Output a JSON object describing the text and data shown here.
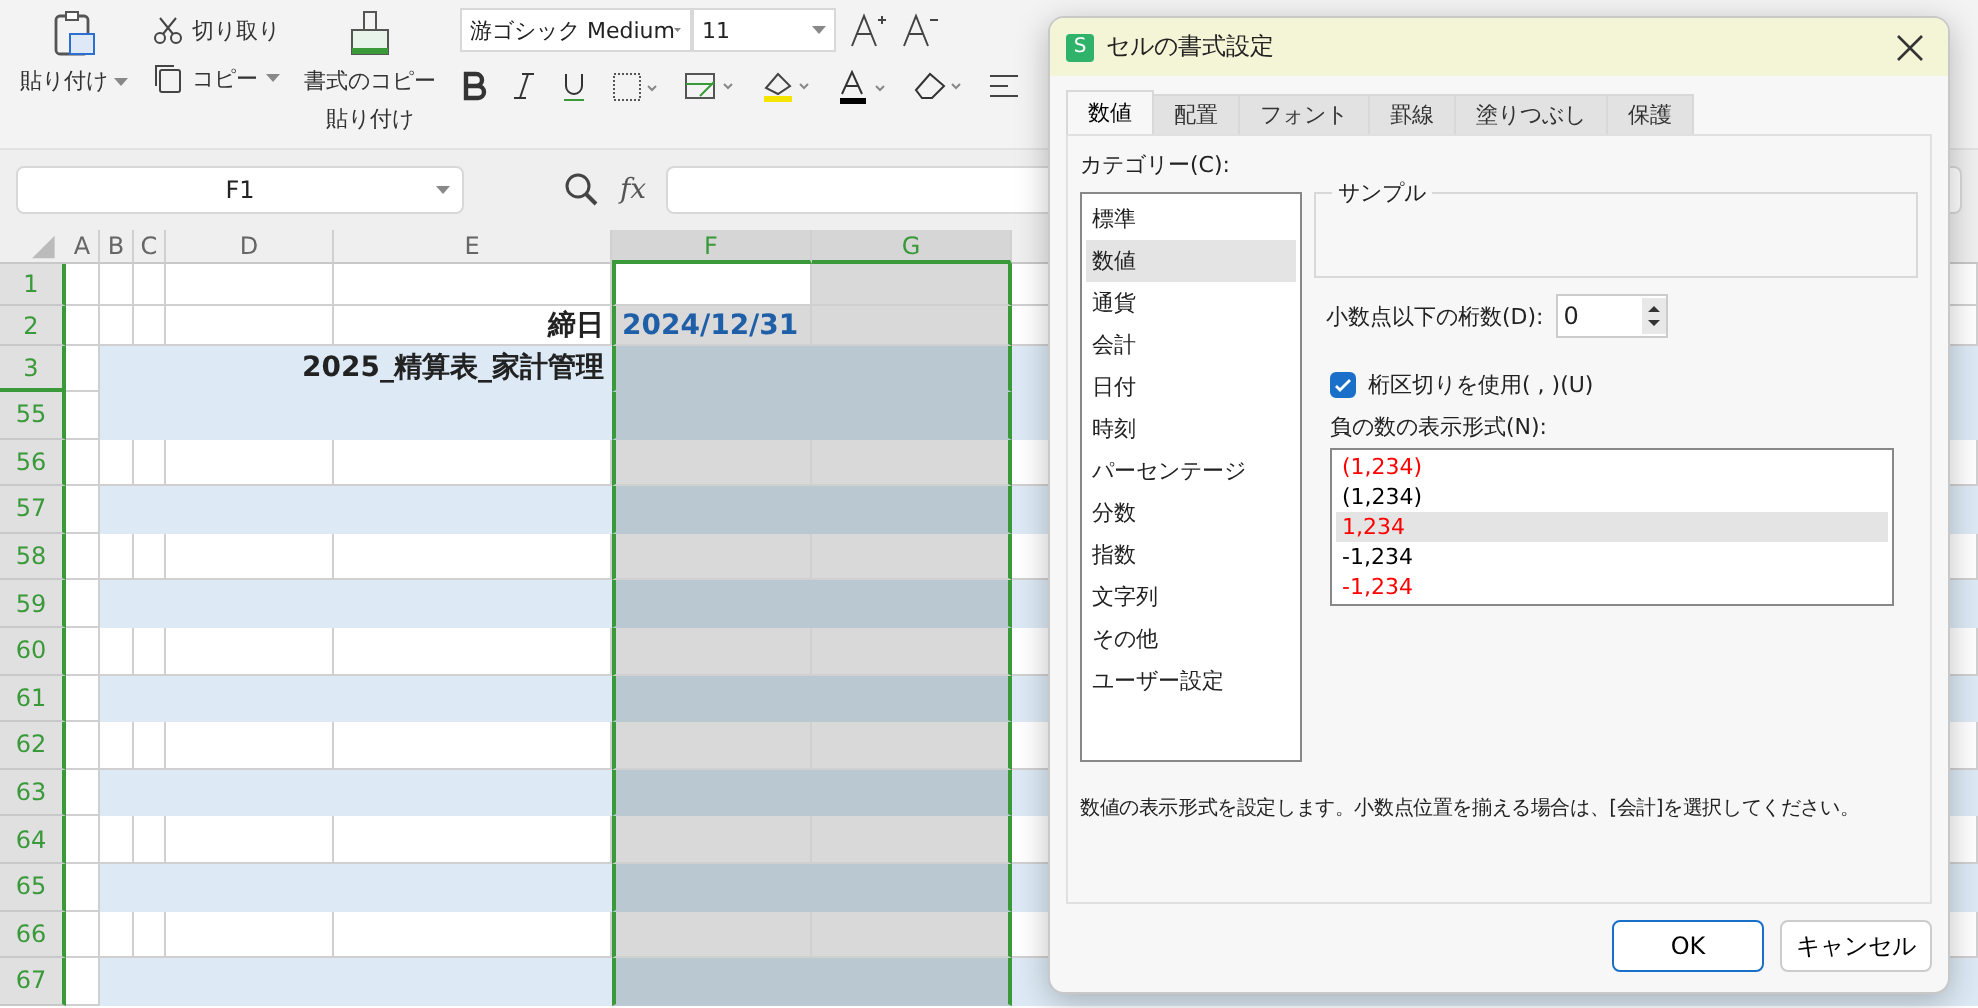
{
  "toolbar": {
    "paste": "貼り付け",
    "cut": "切り取り",
    "copy": "コピー",
    "format_painter": [
      "書式のコピー",
      "貼り付け"
    ],
    "font": "游ゴシック Medium",
    "size": "11"
  },
  "formula_bar": {
    "name_box": "F1",
    "fx": "fx"
  },
  "sheet": {
    "columns": [
      {
        "label": "A",
        "selected": false
      },
      {
        "label": "B",
        "selected": false
      },
      {
        "label": "C",
        "selected": false
      },
      {
        "label": "D",
        "selected": false
      },
      {
        "label": "E",
        "selected": false
      },
      {
        "label": "F",
        "selected": true
      },
      {
        "label": "G",
        "selected": true
      }
    ],
    "rows": [
      {
        "label": "1",
        "kind": "plain",
        "active": true
      },
      {
        "label": "2",
        "kind": "plain",
        "active": false,
        "e": "締日",
        "f": "2024/12/31"
      },
      {
        "label": "3",
        "kind": "title",
        "active": false,
        "e": "2025_精算表_家計管理"
      },
      {
        "label": "55",
        "kind": "band",
        "active": false
      },
      {
        "label": "56",
        "kind": "plain",
        "active": false
      },
      {
        "label": "57",
        "kind": "band",
        "active": false
      },
      {
        "label": "58",
        "kind": "plain",
        "active": false
      },
      {
        "label": "59",
        "kind": "band",
        "active": false
      },
      {
        "label": "60",
        "kind": "plain",
        "active": false
      },
      {
        "label": "61",
        "kind": "band",
        "active": false
      },
      {
        "label": "62",
        "kind": "plain",
        "active": false
      },
      {
        "label": "63",
        "kind": "band",
        "active": false
      },
      {
        "label": "64",
        "kind": "plain",
        "active": false
      },
      {
        "label": "65",
        "kind": "band",
        "active": false
      },
      {
        "label": "66",
        "kind": "plain",
        "active": false
      },
      {
        "label": "67",
        "kind": "band",
        "active": false
      }
    ]
  },
  "dialog": {
    "title": "セルの書式設定",
    "icon_letter": "S",
    "tabs": [
      {
        "label": "数値",
        "selected": true
      },
      {
        "label": "配置",
        "selected": false
      },
      {
        "label": "フォント",
        "selected": false
      },
      {
        "label": "罫線",
        "selected": false
      },
      {
        "label": "塗りつぶし",
        "selected": false
      },
      {
        "label": "保護",
        "selected": false
      }
    ],
    "category_label": "カテゴリー(C):",
    "categories": [
      {
        "label": "標準",
        "selected": false
      },
      {
        "label": "数値",
        "selected": true
      },
      {
        "label": "通貨",
        "selected": false
      },
      {
        "label": "会計",
        "selected": false
      },
      {
        "label": "日付",
        "selected": false
      },
      {
        "label": "時刻",
        "selected": false
      },
      {
        "label": "パーセンテージ",
        "selected": false
      },
      {
        "label": "分数",
        "selected": false
      },
      {
        "label": "指数",
        "selected": false
      },
      {
        "label": "文字列",
        "selected": false
      },
      {
        "label": "その他",
        "selected": false
      },
      {
        "label": "ユーザー設定",
        "selected": false
      }
    ],
    "sample_label": "サンプル",
    "decimals_label": "小数点以下の桁数(D):",
    "decimals": "0",
    "separator": {
      "label": "桁区切りを使用( , )(U)",
      "checked": true
    },
    "negative_label": "負の数の表示形式(N):",
    "negative_formats": [
      {
        "label": "(1,234)",
        "color": "#ff0000",
        "selected": false
      },
      {
        "label": "(1,234)",
        "color": "#000000",
        "selected": false
      },
      {
        "label": "1,234",
        "color": "#ff0000",
        "selected": true
      },
      {
        "label": "-1,234",
        "color": "#000000",
        "selected": false
      },
      {
        "label": "-1,234",
        "color": "#ff0000",
        "selected": false
      }
    ],
    "description": "数値の表示形式を設定します。小数点位置を揃える場合は、[会計]を選択してください。",
    "buttons": [
      {
        "label": "OK",
        "kind": "primary"
      },
      {
        "label": "キャンセル",
        "kind": "secondary"
      }
    ]
  }
}
